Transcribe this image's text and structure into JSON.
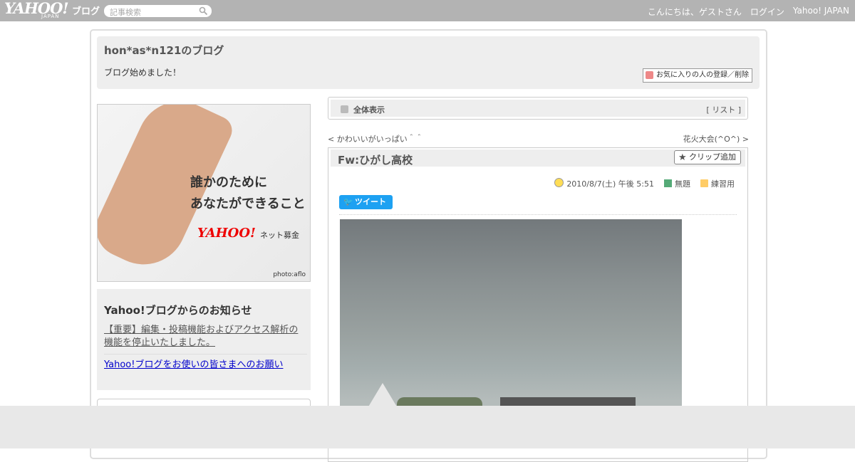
{
  "topbar": {
    "logo": "YAHOO!",
    "logo_sub": "JAPAN",
    "logo_blog": "ブログ",
    "search_placeholder": "記事検索",
    "greeting": "こんにちは、ゲストさん",
    "login": "ログイン",
    "yahoo_japan": "Yahoo! JAPAN"
  },
  "header": {
    "blog_title": "hon*as*n121のブログ",
    "blog_desc": "ブログ始めました！",
    "favorite_button": "お気に入りの人の登録／削除"
  },
  "banner": {
    "line1": "誰かのために",
    "line2": "あなたができること",
    "logo": "YAHOO!",
    "fund": "ネット募金",
    "photo_credit": "photo:aflo"
  },
  "news": {
    "title": "Yahoo!ブログからのお知らせ",
    "item1": "【重要】編集・投稿機能およびアクセス解析の機能を停止いたしました。",
    "item2": "Yahoo!ブログをお使いの皆さまへのお願い"
  },
  "view": {
    "label": "全体表示",
    "list_prefix": "[ ",
    "list_link": "リスト",
    "list_suffix": " ]"
  },
  "pager": {
    "prev_mark": "< ",
    "prev": "かわいいがいっぱい＾＾",
    "next": "花火大会(^O^)",
    "next_mark": " >"
  },
  "article": {
    "title": "Fw:ひがし高校",
    "clip_button": "クリップ追加",
    "date": "2010/8/7(土) 午後 5:51",
    "theme": "無題",
    "category": "練習用",
    "tweet": "ツイート"
  }
}
